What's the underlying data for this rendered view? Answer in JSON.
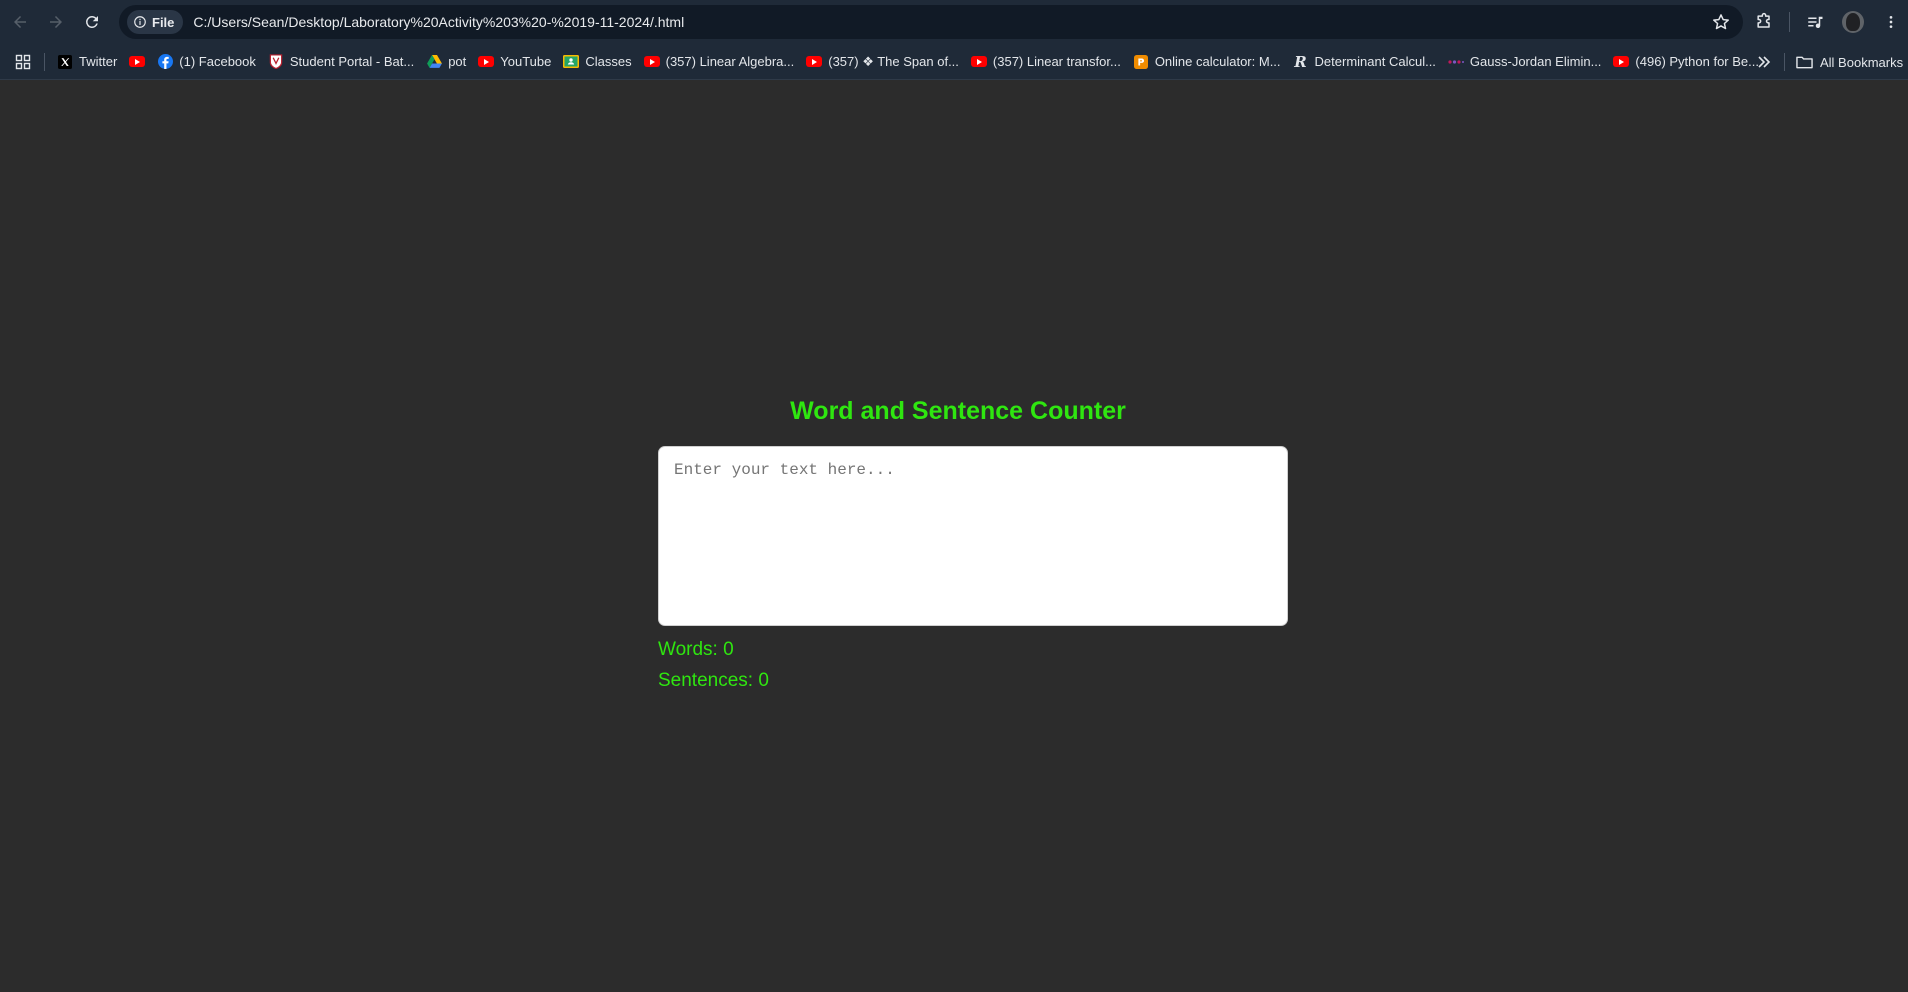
{
  "browser": {
    "chip_label": "File",
    "url": "C:/Users/Sean/Desktop/Laboratory%20Activity%203%20-%2019-11-2024/.html",
    "bookmarks": [
      {
        "label": "Twitter",
        "icon": "x-logo-icon"
      },
      {
        "label": "",
        "icon": "youtube-icon"
      },
      {
        "label": "(1) Facebook",
        "icon": "facebook-icon"
      },
      {
        "label": "Student Portal - Bat...",
        "icon": "portal-shield-icon"
      },
      {
        "label": "pot",
        "icon": "google-drive-icon"
      },
      {
        "label": "YouTube",
        "icon": "youtube-icon"
      },
      {
        "label": "Classes",
        "icon": "google-classroom-icon"
      },
      {
        "label": "(357) Linear Algebra...",
        "icon": "youtube-icon"
      },
      {
        "label": "(357) ❖ The Span of...",
        "icon": "youtube-icon"
      },
      {
        "label": "(357) Linear transfor...",
        "icon": "youtube-icon"
      },
      {
        "label": "Online calculator: M...",
        "icon": "calculator-icon"
      },
      {
        "label": "Determinant Calcul...",
        "icon": "r-logo-icon"
      },
      {
        "label": "Gauss-Jordan Elimin...",
        "icon": "dots-icon"
      },
      {
        "label": "(496) Python for Be...",
        "icon": "youtube-icon"
      }
    ],
    "all_bookmarks_label": "All Bookmarks"
  },
  "page": {
    "title": "Word and Sentence Counter",
    "input_placeholder": "Enter your text here...",
    "words_text": "Words: 0",
    "sentences_text": "Sentences: 0"
  },
  "colors": {
    "accent_green": "#2fe610",
    "page_background": "#2c2c2c",
    "toolbar_background": "#1f2a38"
  }
}
